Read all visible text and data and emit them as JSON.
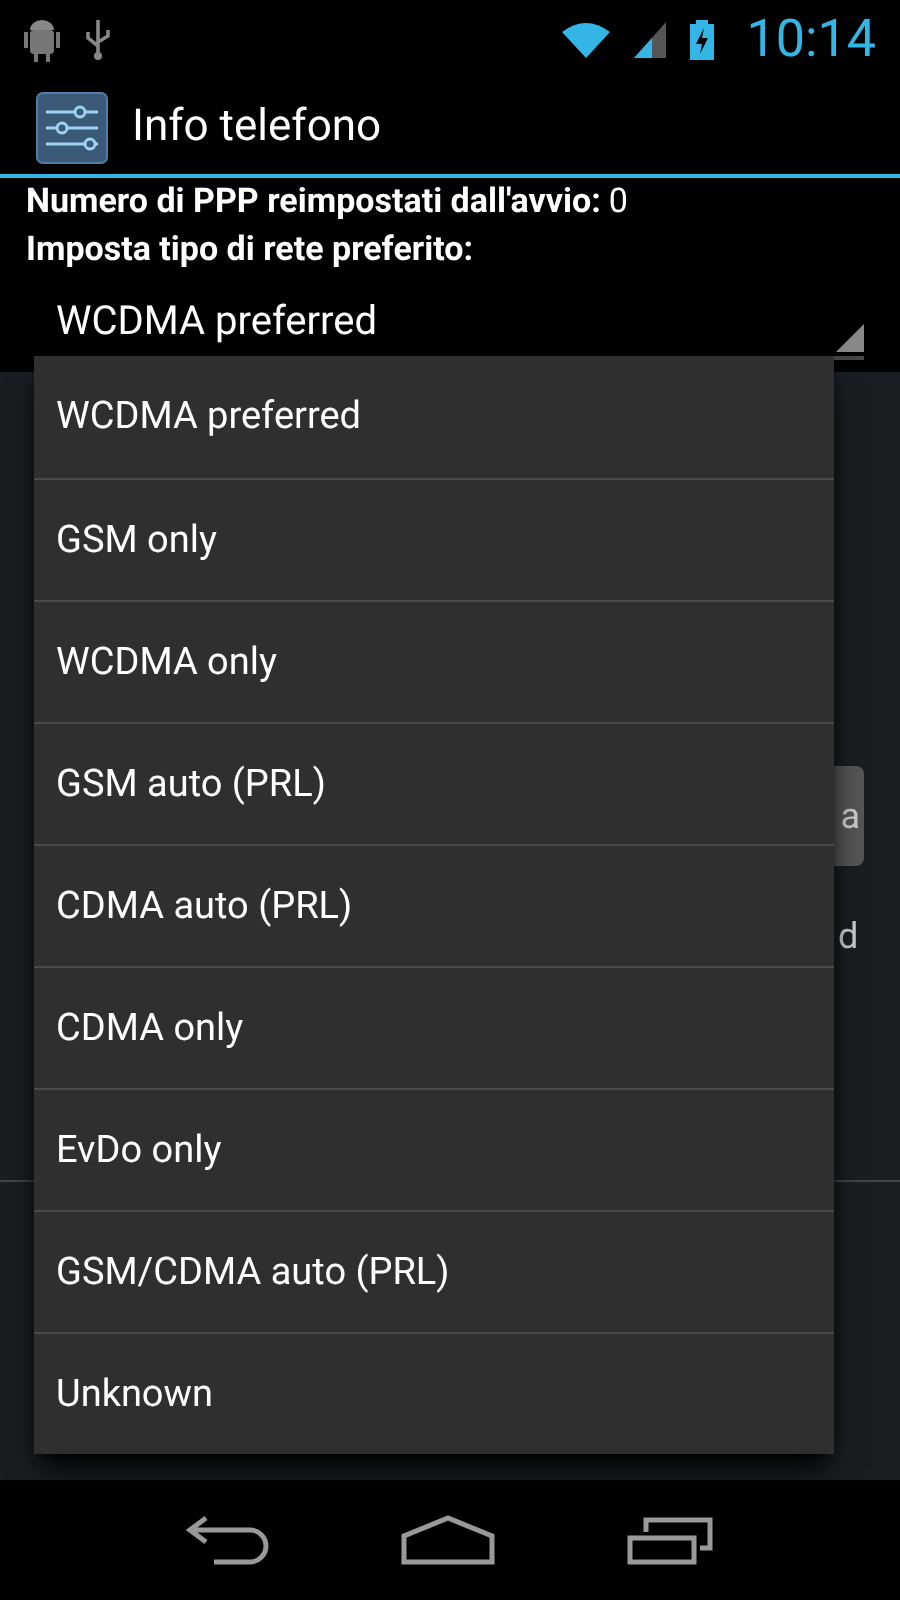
{
  "status_bar": {
    "time": "10:14"
  },
  "action_bar": {
    "title": "Info telefono"
  },
  "info": [
    {
      "label": "Numero di PPP reimpostati dall'avvio:",
      "value": "0"
    },
    {
      "label": "Imposta tipo di rete preferito:"
    }
  ],
  "network_spinner": {
    "value": "WCDMA preferred"
  },
  "behind": {
    "button_fragment": "a",
    "text_fragment": "d"
  },
  "dropdown": {
    "options": [
      "WCDMA preferred",
      "GSM only",
      "WCDMA only",
      "GSM auto (PRL)",
      "CDMA auto (PRL)",
      "CDMA only",
      "EvDo only",
      "GSM/CDMA auto (PRL)",
      "Unknown"
    ]
  }
}
